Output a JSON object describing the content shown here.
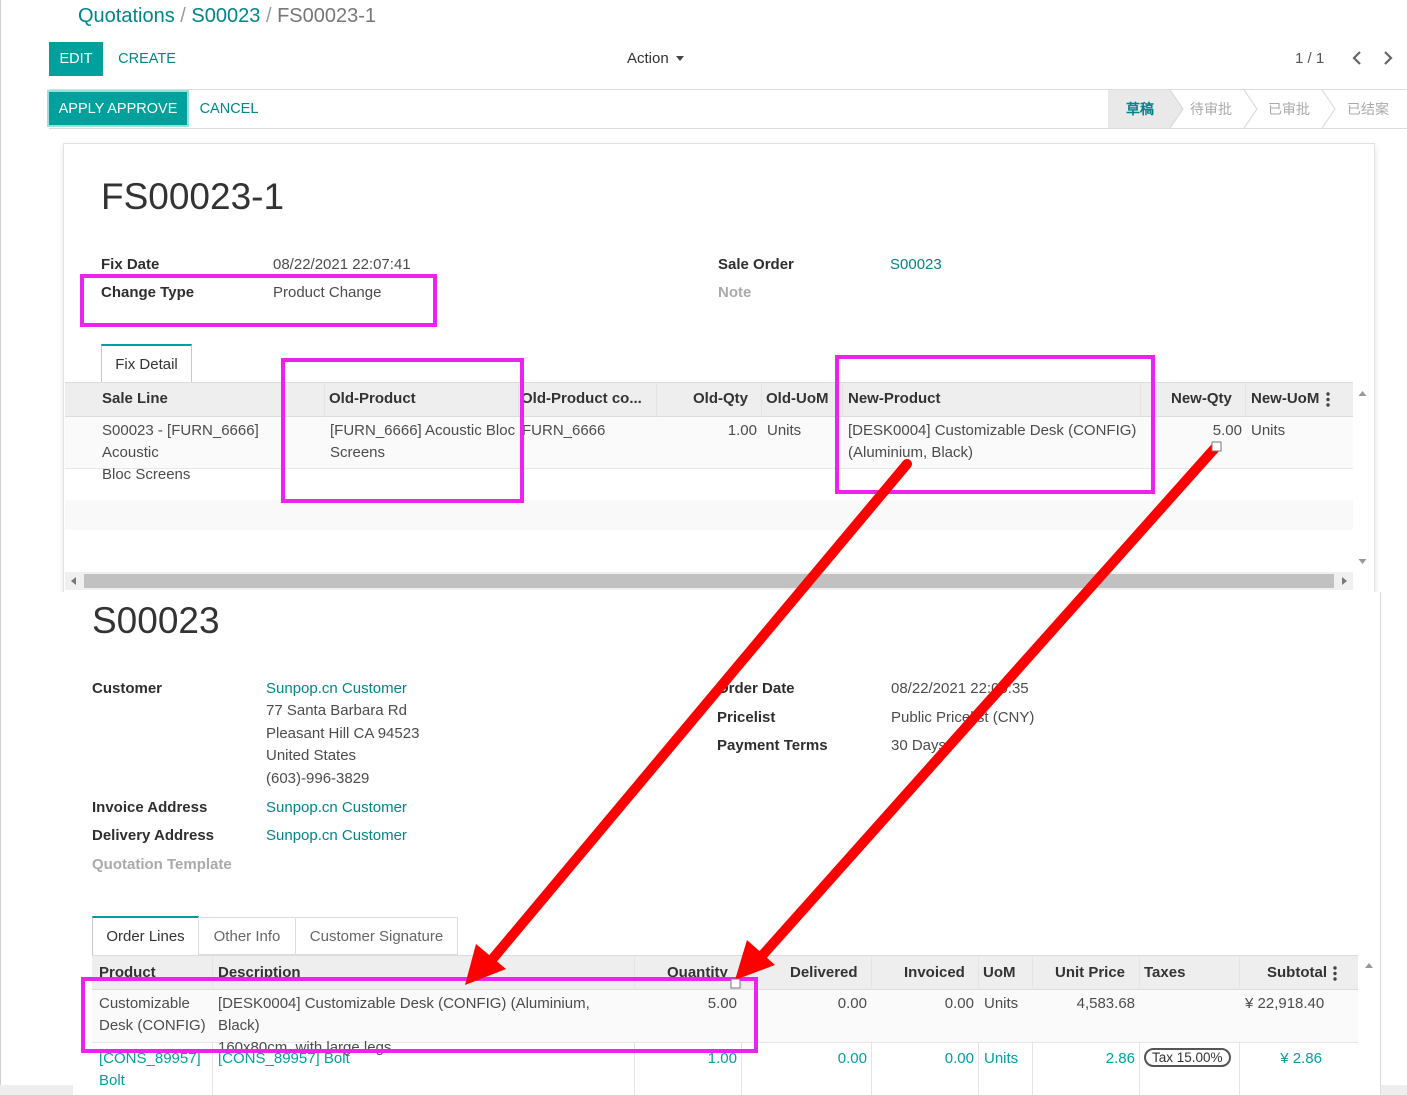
{
  "breadcrumb": {
    "root": "Quotations",
    "sep1": "/",
    "parent": "S00023",
    "sep2": "/",
    "current": "FS00023-1"
  },
  "control_panel": {
    "edit_label": "EDIT",
    "create_label": "CREATE",
    "action_label": "Action",
    "pager": "1 / 1"
  },
  "statusbar": {
    "apply_label": "APPLY APPROVE",
    "cancel_label": "CANCEL",
    "stages": [
      "草稿",
      "待审批",
      "已审批",
      "已结案"
    ],
    "active_stage": 0
  },
  "fix": {
    "title": "FS00023-1",
    "fix_date_label": "Fix Date",
    "fix_date": "08/22/2021 22:07:41",
    "change_type_label": "Change Type",
    "change_type": "Product Change",
    "sale_order_label": "Sale Order",
    "sale_order": "S00023",
    "note_label": "Note",
    "tab_label": "Fix Detail",
    "columns": [
      "Sale Line",
      "Old-Product",
      "Old-Product co...",
      "Old-Qty",
      "Old-UoM",
      "New-Product",
      "New-Qty",
      "New-UoM"
    ],
    "row": {
      "sale_line_1": "S00023 - [FURN_6666] Acoustic",
      "sale_line_2": "Bloc Screens",
      "old_product_1": "[FURN_6666] Acoustic Bloc",
      "old_product_2": "Screens",
      "old_code": "FURN_6666",
      "old_qty": "1.00",
      "old_uom": "Units",
      "new_product_1": "[DESK0004] Customizable Desk (CONFIG)",
      "new_product_2": "(Aluminium, Black)",
      "new_qty": "5.00",
      "new_uom": "Units"
    }
  },
  "order": {
    "title": "S00023",
    "customer_label": "Customer",
    "customer": "Sunpop.cn Customer",
    "address": [
      "77 Santa Barbara Rd",
      "Pleasant Hill CA 94523",
      "United States",
      "(603)-996-3829"
    ],
    "invoice_label": "Invoice Address",
    "invoice": "Sunpop.cn Customer",
    "delivery_label": "Delivery Address",
    "delivery": "Sunpop.cn Customer",
    "template_label": "Quotation Template",
    "order_date_label": "Order Date",
    "order_date": "08/22/2021 22:06:35",
    "pricelist_label": "Pricelist",
    "pricelist": "Public Pricelist (CNY)",
    "terms_label": "Payment Terms",
    "terms": "30 Days",
    "tabs": [
      "Order Lines",
      "Other Info",
      "Customer Signature"
    ],
    "columns": [
      "Product",
      "Description",
      "Quantity",
      "Delivered",
      "Invoiced",
      "UoM",
      "Unit Price",
      "Taxes",
      "Subtotal"
    ],
    "line1": {
      "product_1": "Customizable",
      "product_2": "Desk (CONFIG)",
      "desc_1": "[DESK0004] Customizable Desk (CONFIG) (Aluminium, Black)",
      "desc_2": "160x80cm, with large legs.",
      "qty": "5.00",
      "delivered": "0.00",
      "invoiced": "0.00",
      "uom": "Units",
      "price": "4,583.68",
      "subtotal": "¥ 22,918.40"
    },
    "line2": {
      "product_1": "[CONS_89957]",
      "product_2": "Bolt",
      "desc_1": "[CONS_89957] Bolt",
      "qty": "1.00",
      "delivered": "0.00",
      "invoiced": "0.00",
      "uom": "Units",
      "price": "2.86",
      "tax": "Tax 15.00%",
      "subtotal": "¥ 2.86"
    }
  },
  "colors": {
    "accent": "#00a09d",
    "link": "#00858a",
    "highlight": "#ee22ee",
    "arrow": "#ff0000"
  }
}
